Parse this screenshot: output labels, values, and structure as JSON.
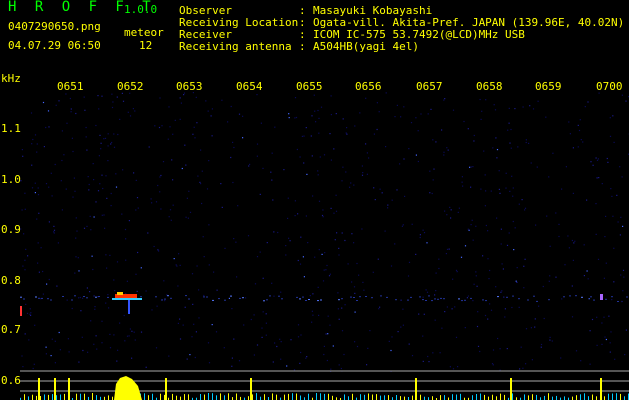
{
  "app": {
    "title": "H R O F F T",
    "version": "1.0.0"
  },
  "file_name": "0407290650.png",
  "meteor": {
    "label": "meteor",
    "count": "12"
  },
  "datetime": "04.07.29 06:50",
  "info": [
    {
      "key": "Observer",
      "sep": ":",
      "value": "Masayuki Kobayashi"
    },
    {
      "key": "Receiving Location",
      "sep": ":",
      "value": "Ogata-vill. Akita-Pref. JAPAN (139.96E, 40.02N)"
    },
    {
      "key": "Receiver",
      "sep": ":",
      "value": "ICOM IC-575 53.7492(@LCD)MHz USB"
    },
    {
      "key": "Receiving antenna",
      "sep": ":",
      "value": "A504HB(yagi 4el)"
    }
  ],
  "axis": {
    "unit": "kHz",
    "time_ticks": [
      "0651",
      "0652",
      "0653",
      "0654",
      "0655",
      "0656",
      "0657",
      "0658",
      "0659",
      "0700"
    ],
    "freq_ticks": [
      "1.1",
      "1.0",
      "0.9",
      "0.8",
      "0.7",
      "0.6"
    ]
  },
  "colors": {
    "bg": "#000000",
    "text": "#ffff00",
    "title": "#00ff00",
    "info_value": "#00ffff",
    "noise": "#0a0a55",
    "signal_hot": "#ff3300",
    "panel_line": "#ffffff",
    "panel_bars": "#ffff00"
  }
}
